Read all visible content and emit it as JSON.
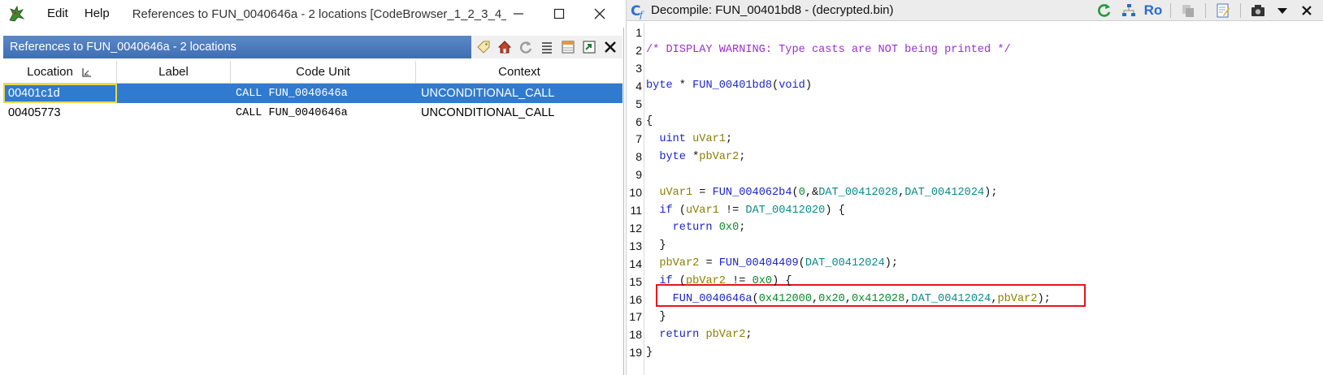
{
  "left_window": {
    "menu": [
      "Edit",
      "Help"
    ],
    "title": "References to FUN_0040646a - 2 locations [CodeBrowser_1_2_3_4_5_",
    "panel_title": "References to FUN_0040646a - 2 locations",
    "columns": [
      "Location",
      "Label",
      "Code Unit",
      "Context"
    ],
    "rows": [
      {
        "location": "00401c1d",
        "label": "",
        "code_unit": "CALL FUN_0040646a",
        "context": "UNCONDITIONAL_CALL"
      },
      {
        "location": "00405773",
        "label": "",
        "code_unit": "CALL FUN_0040646a",
        "context": "UNCONDITIONAL_CALL"
      }
    ]
  },
  "right_window": {
    "title": "Decompile: FUN_00401bd8 -  (decrypted.bin)",
    "ro_label": "Ro",
    "code_lines": [
      {
        "n": "1",
        "text": ""
      },
      {
        "n": "2",
        "text": "/* DISPLAY WARNING: Type casts are NOT being printed */"
      },
      {
        "n": "3",
        "text": ""
      },
      {
        "n": "4",
        "text": "byte * FUN_00401bd8(void)"
      },
      {
        "n": "5",
        "text": ""
      },
      {
        "n": "6",
        "text": "{"
      },
      {
        "n": "7",
        "text": "  uint uVar1;"
      },
      {
        "n": "8",
        "text": "  byte *pbVar2;"
      },
      {
        "n": "9",
        "text": ""
      },
      {
        "n": "10",
        "text": "  uVar1 = FUN_004062b4(0,&DAT_00412028,DAT_00412024);"
      },
      {
        "n": "11",
        "text": "  if (uVar1 != DAT_00412020) {"
      },
      {
        "n": "12",
        "text": "    return 0x0;"
      },
      {
        "n": "13",
        "text": "  }"
      },
      {
        "n": "14",
        "text": "  pbVar2 = FUN_00404409(DAT_00412024);"
      },
      {
        "n": "15",
        "text": "  if (pbVar2 != 0x0) {"
      },
      {
        "n": "16",
        "text": "    FUN_0040646a(0x412000,0x20,0x412028,DAT_00412024,pbVar2);"
      },
      {
        "n": "17",
        "text": "  }"
      },
      {
        "n": "18",
        "text": "  return pbVar2;"
      },
      {
        "n": "19",
        "text": "}"
      }
    ]
  },
  "colors": {
    "selection": "#2f7bd0",
    "panel_header": "#4a79bd",
    "highlight_box": "#e8141c",
    "comment": "#9a2fd0",
    "keyword": "#1c25c9",
    "variable": "#8b7f00",
    "number": "#0a8a2a",
    "global": "#0b8a8a"
  }
}
